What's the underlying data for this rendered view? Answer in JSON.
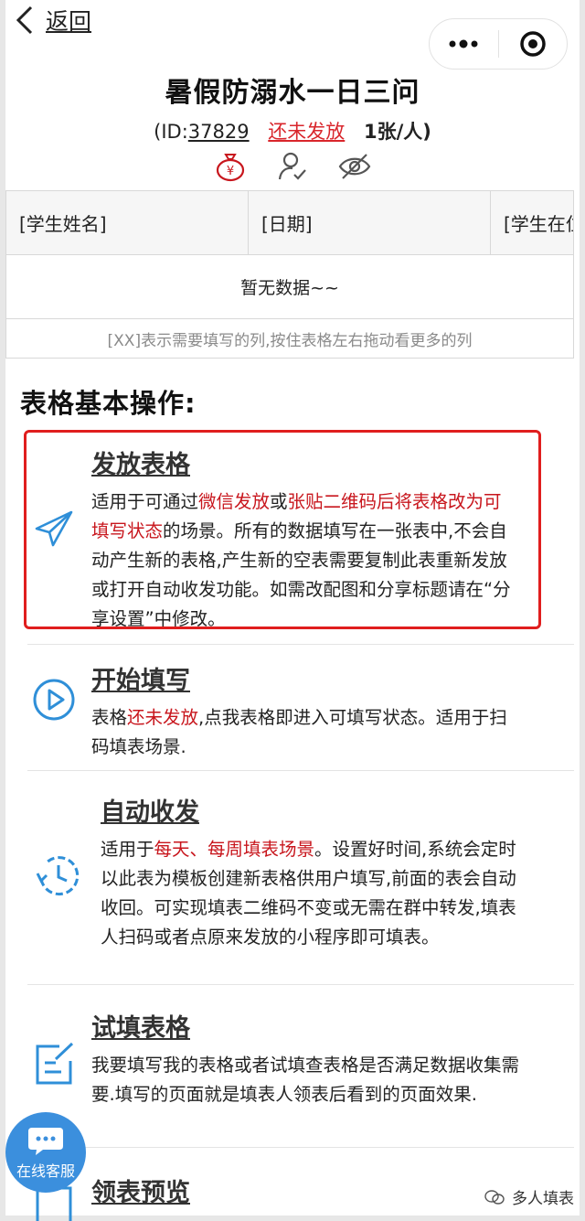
{
  "nav": {
    "back_label": "返回"
  },
  "header": {
    "title": "暑假防溺水一日三问",
    "id_prefix": "(ID:",
    "id_value": "37829",
    "status": "还未发放",
    "per_person": "1张/人)"
  },
  "table": {
    "columns": [
      "[学生姓名]",
      "[日期]",
      "[学生在位置]"
    ],
    "empty_text": "暂无数据~~",
    "hint": "[XX]表示需要填写的列,按住表格左右拖动看更多的列"
  },
  "section": {
    "title": "表格基本操作:"
  },
  "cards": {
    "publish": {
      "title": "发放表格",
      "t1": "适用于可通过",
      "r1": "微信发放",
      "t2": "或",
      "r2": "张贴二维码后将表格改为可填写状态",
      "t3": "的场景。所有的数据填写在一张表中,不会自动产生新的表格,产生新的空表需要复制此表重新发放或打开自动收发功能。如需改配图和分享标题请在“分享设置”中修改。"
    },
    "start": {
      "title": "开始填写",
      "t1": "表格",
      "r1": "还未发放",
      "t2": ",点我表格即进入可填写状态。适用于扫码填表场景."
    },
    "auto": {
      "title": "自动收发",
      "t1": "适用于",
      "r1": "每天、每周填表场景",
      "t2": "。设置好时间,系统会定时以此表为模板创建新表格供用户填写,前面的表会自动收回。可实现填表二维码不变或无需在群中转发,填表人扫码或者点原来发放的小程序即可填表。"
    },
    "trial": {
      "title": "试填表格",
      "t1": "我要填写我的表格或者试填查表格是否满足数据收集需要.填写的页面就是填表人领表后看到的页面效果."
    },
    "preview": {
      "title": "领表预览"
    }
  },
  "service": {
    "label": "在线客服"
  },
  "watermark": {
    "label": "多人填表"
  },
  "colors": {
    "accent_blue": "#2f8fd8",
    "highlight_red": "#c8161d",
    "box_red": "#e01e1e"
  }
}
